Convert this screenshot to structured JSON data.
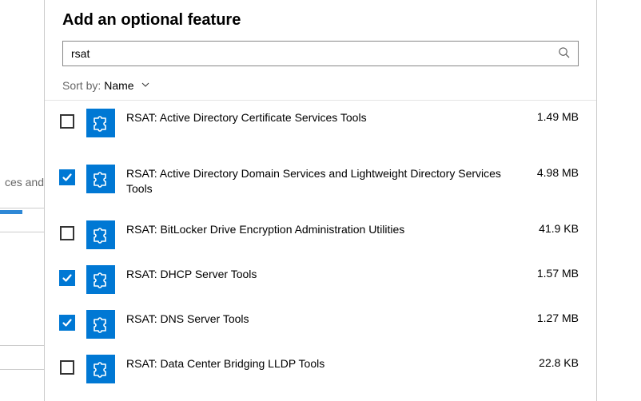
{
  "bg": {
    "fragment": "ces and"
  },
  "header": {
    "title": "Add an optional feature",
    "search_value": "rsat",
    "search_placeholder": ""
  },
  "sort": {
    "label": "Sort by:",
    "value": "Name"
  },
  "items": [
    {
      "checked": false,
      "label": "RSAT: Active Directory Certificate Services Tools",
      "size": "1.49 MB"
    },
    {
      "checked": true,
      "label": "RSAT: Active Directory Domain Services and Lightweight Directory Services Tools",
      "size": "4.98 MB"
    },
    {
      "checked": false,
      "label": "RSAT: BitLocker Drive Encryption Administration Utilities",
      "size": "41.9 KB"
    },
    {
      "checked": true,
      "label": "RSAT: DHCP Server Tools",
      "size": "1.57 MB"
    },
    {
      "checked": true,
      "label": "RSAT: DNS Server Tools",
      "size": "1.27 MB"
    },
    {
      "checked": false,
      "label": "RSAT: Data Center Bridging LLDP Tools",
      "size": "22.8 KB"
    }
  ]
}
